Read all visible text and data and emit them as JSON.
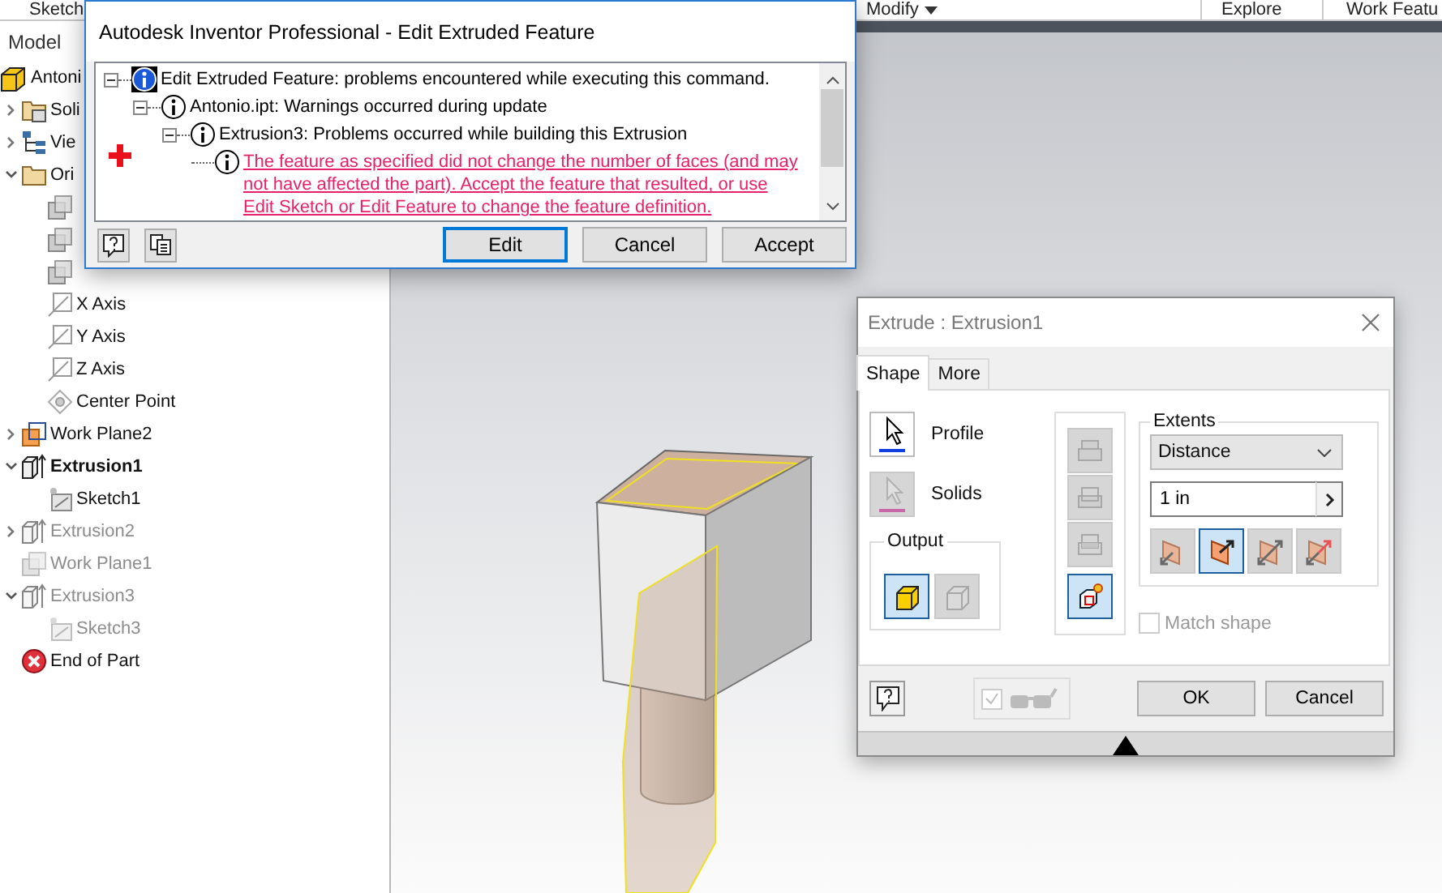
{
  "ribbon": {
    "tabs": [
      {
        "label": "Sketch",
        "dropdown": false
      },
      {
        "label": "Modify",
        "dropdown": true
      },
      {
        "label": "Explore",
        "dropdown": false
      },
      {
        "label": "Work Featu",
        "dropdown": false
      }
    ]
  },
  "model_panel": {
    "title": "Model",
    "tree": [
      {
        "label": "Antoni",
        "kind": "part",
        "active": false,
        "disabled": false,
        "children": [
          {
            "label": "Soli",
            "kind": "solids",
            "expanded": false,
            "active": false,
            "disabled": false
          },
          {
            "label": "Vie",
            "kind": "view",
            "expanded": false,
            "active": false,
            "disabled": false
          },
          {
            "label": "Ori",
            "kind": "folder",
            "expanded": true,
            "active": false,
            "disabled": false,
            "children": [
              {
                "kind": "plane",
                "disabled": false
              },
              {
                "kind": "plane",
                "disabled": false
              },
              {
                "kind": "plane",
                "disabled": false
              },
              {
                "label": "X Axis",
                "kind": "axis",
                "active": false,
                "disabled": false
              },
              {
                "label": "Y Axis",
                "kind": "axis",
                "active": false,
                "disabled": false
              },
              {
                "label": "Z Axis",
                "kind": "axis",
                "active": false,
                "disabled": false
              },
              {
                "label": "Center Point",
                "kind": "point",
                "active": false,
                "disabled": false
              }
            ]
          },
          {
            "label": "Work Plane2",
            "kind": "workplane",
            "expanded": false,
            "active": false,
            "disabled": false
          },
          {
            "label": "Extrusion1",
            "kind": "extrusion",
            "expanded": true,
            "active": true,
            "disabled": false,
            "children": [
              {
                "label": "Sketch1",
                "kind": "sketch",
                "active": false,
                "disabled": false
              }
            ]
          },
          {
            "label": "Extrusion2",
            "kind": "extrusion",
            "expanded": false,
            "active": false,
            "disabled": true
          },
          {
            "label": "Work Plane1",
            "kind": "plane",
            "active": false,
            "disabled": true
          },
          {
            "label": "Extrusion3",
            "kind": "extrusion",
            "expanded": true,
            "active": false,
            "disabled": true,
            "children": [
              {
                "label": "Sketch3",
                "kind": "sketch",
                "active": false,
                "disabled": true
              }
            ]
          },
          {
            "label": "End of Part",
            "kind": "end",
            "active": false,
            "disabled": false
          }
        ]
      }
    ]
  },
  "error_dialog": {
    "title": "Autodesk Inventor Professional - Edit Extruded Feature",
    "messages": [
      {
        "text": "Edit Extruded Feature: problems encountered while executing this command.",
        "kind": "info",
        "selected": true,
        "expanded": true,
        "children": [
          {
            "text": "Antonio.ipt: Warnings occurred during update",
            "kind": "info",
            "selected": false,
            "expanded": true,
            "children": [
              {
                "text": "Extrusion3: Problems occurred while building this Extrusion",
                "kind": "info",
                "selected": false,
                "expanded": true,
                "children": [
                  {
                    "text": "The feature as specified did not change the number of faces (and may not have affected the part).  Accept the feature that resulted, or use Edit Sketch or Edit Feature to change the feature definition.",
                    "kind": "link",
                    "selected": false
                  }
                ]
              }
            ]
          }
        ]
      }
    ],
    "buttons": [
      {
        "label": "Edit",
        "default": true
      },
      {
        "label": "Cancel",
        "default": false
      },
      {
        "label": "Accept",
        "default": false
      }
    ]
  },
  "extrude_dialog": {
    "title": "Extrude : Extrusion1",
    "tabs": [
      {
        "label": "Shape",
        "selected": true
      },
      {
        "label": "More",
        "selected": false
      }
    ],
    "selectors": [
      {
        "label": "Profile",
        "kind": "profile",
        "disabled": false
      },
      {
        "label": "Solids",
        "kind": "solids",
        "disabled": true
      }
    ],
    "output": {
      "label": "Output",
      "options": [
        {
          "kind": "solid",
          "selected": true
        },
        {
          "kind": "surface",
          "selected": false
        }
      ]
    },
    "operations": [
      {
        "kind": "join",
        "selected": false,
        "disabled": true
      },
      {
        "kind": "cut",
        "selected": false,
        "disabled": true
      },
      {
        "kind": "intersect",
        "selected": false,
        "disabled": true
      },
      {
        "kind": "new-solid",
        "selected": true,
        "disabled": false
      }
    ],
    "extents": {
      "label": "Extents",
      "method": "Distance",
      "distance": "1 in",
      "directions": [
        {
          "kind": "flip",
          "selected": false
        },
        {
          "kind": "default",
          "selected": true
        },
        {
          "kind": "symmetric",
          "selected": false
        },
        {
          "kind": "asymmetric",
          "selected": false
        }
      ]
    },
    "match_shape": {
      "label": "Match shape",
      "checked": false,
      "disabled": true
    },
    "preview": {
      "checked": true,
      "disabled": true
    },
    "buttons": [
      {
        "label": "OK"
      },
      {
        "label": "Cancel"
      }
    ]
  }
}
